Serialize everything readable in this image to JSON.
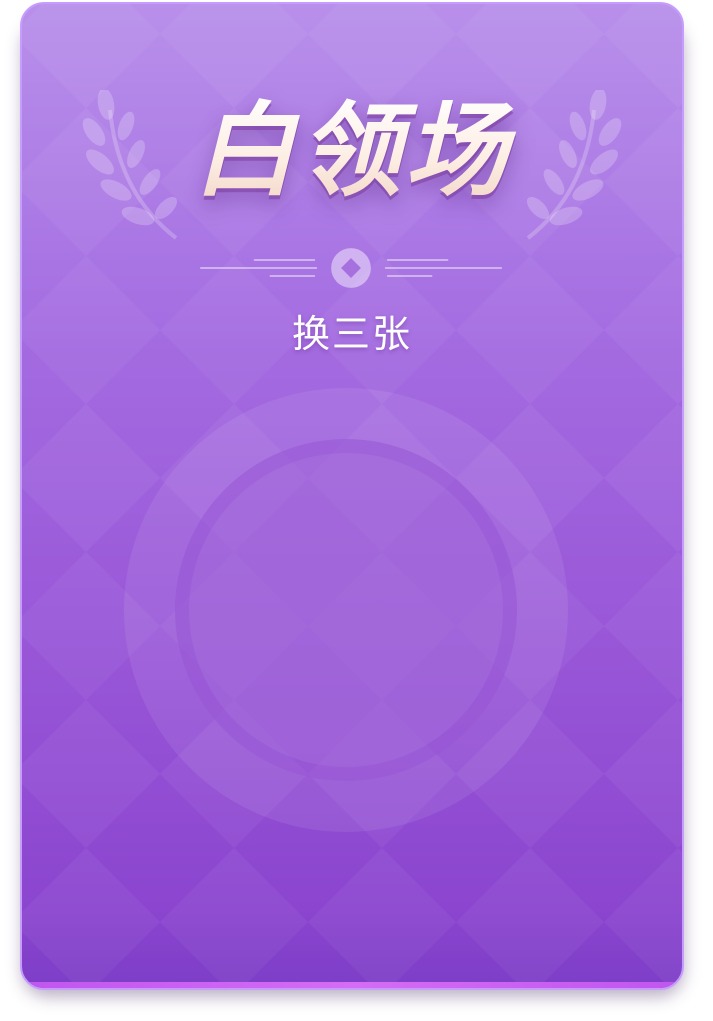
{
  "card": {
    "title": "白领场",
    "subtitle": "换三张"
  },
  "icons": {
    "left_decoration": "laurel-branch-icon",
    "right_decoration": "laurel-branch-icon",
    "divider_center": "diamond-coin-icon",
    "center": "ring-icon"
  },
  "colors": {
    "card_top": "#b083e8",
    "card_bottom": "#8b45cf",
    "card_border": "#c79cff",
    "title_top": "#ffffff",
    "title_bottom": "#f1d3c4",
    "subtitle": "#ffffff"
  }
}
